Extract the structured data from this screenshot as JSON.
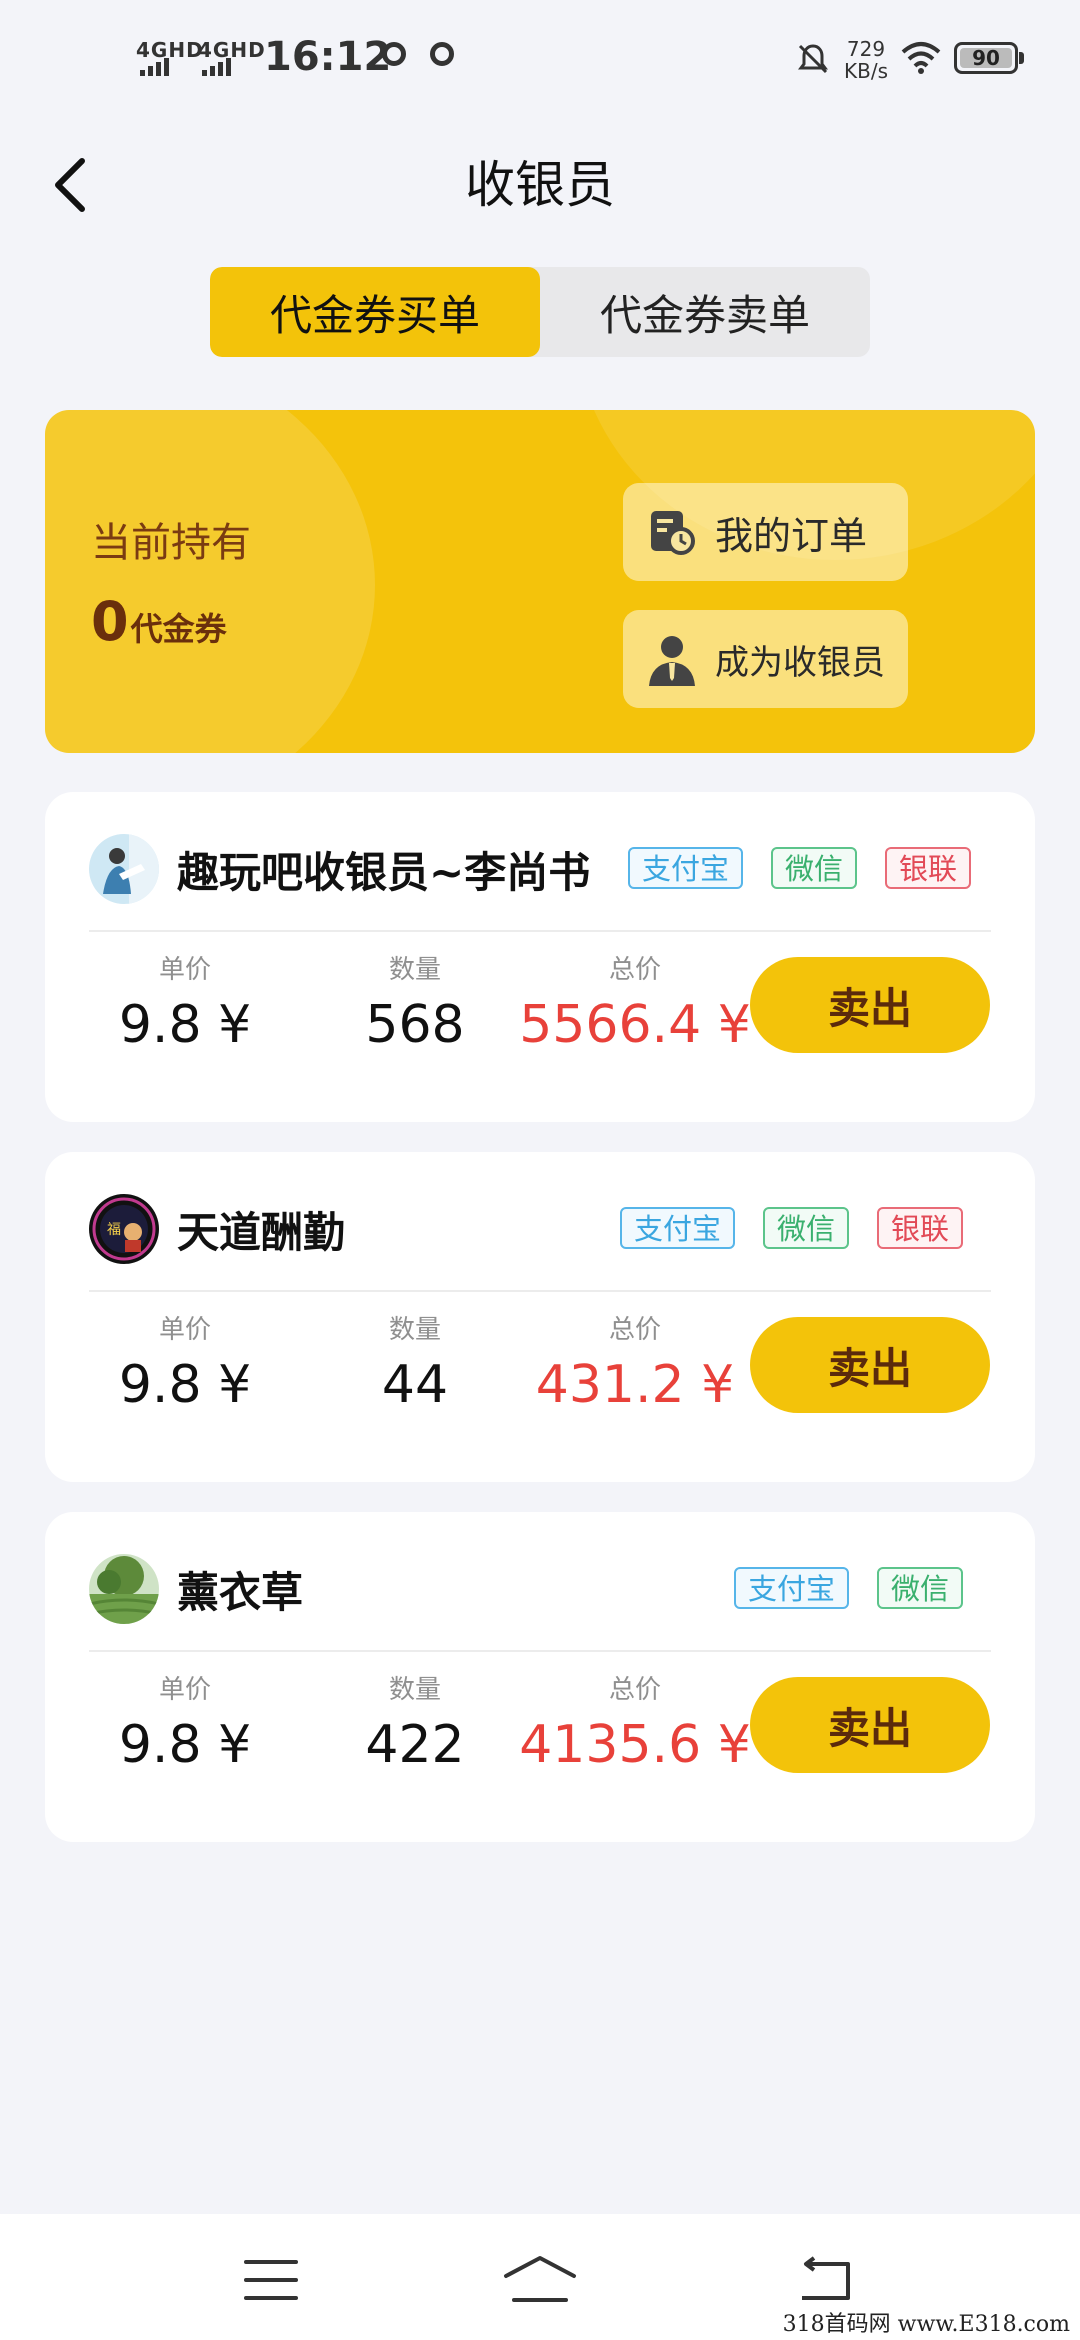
{
  "status_bar": {
    "network_1": "4GHD",
    "network_2": "4GHD",
    "time": "16:12",
    "speed_value": "729",
    "speed_unit": "KB/s",
    "battery": "90"
  },
  "header": {
    "title": "收银员",
    "back_icon": "chevron-left-icon"
  },
  "tabs": [
    {
      "label": "代金券买单",
      "active": true
    },
    {
      "label": "代金券卖单",
      "active": false
    }
  ],
  "holdings": {
    "label": "当前持有",
    "amount": "0",
    "unit": "代金券",
    "orders_button": "我的订单",
    "become_cashier_button": "成为收银员"
  },
  "columns": {
    "unit_price": "单价",
    "quantity": "数量",
    "total": "总价"
  },
  "sellers": [
    {
      "name": "趣玩吧收银员~李尚书",
      "badges": [
        "支付宝",
        "微信",
        "银联"
      ],
      "unit_price": "9.8 ¥",
      "quantity": "568",
      "total": "5566.4 ¥",
      "action": "卖出"
    },
    {
      "name": "天道酬勤",
      "badges": [
        "支付宝",
        "微信",
        "银联"
      ],
      "unit_price": "9.8 ¥",
      "quantity": "44",
      "total": "431.2 ¥",
      "action": "卖出"
    },
    {
      "name": "薰衣草",
      "badges": [
        "支付宝",
        "微信"
      ],
      "unit_price": "9.8 ¥",
      "quantity": "422",
      "total": "4135.6 ¥",
      "action": "卖出"
    }
  ],
  "bottom_nav": [
    "menu-icon",
    "home-icon",
    "back-icon"
  ],
  "watermark": "318首码网 www.E318.com",
  "colors": {
    "accent": "#f3c30a",
    "total_red": "#e8413a",
    "alipay": "#3aa6e0",
    "wechat": "#3ab06e",
    "unionpay": "#e24a57"
  }
}
